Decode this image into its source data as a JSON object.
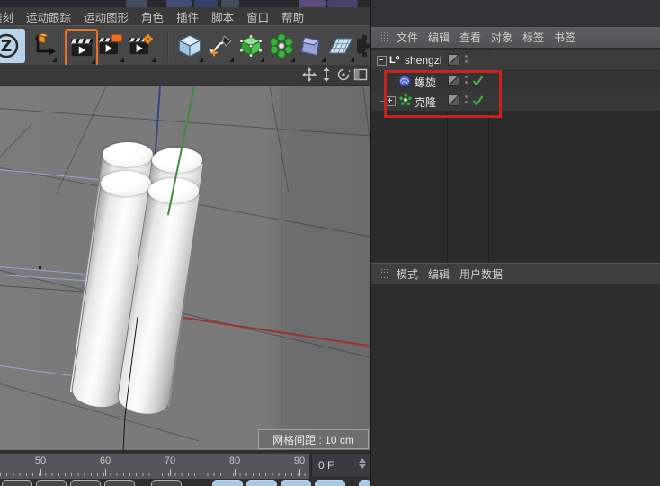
{
  "menubar": {
    "items": [
      "雕刻",
      "运动跟踪",
      "运动图形",
      "角色",
      "插件",
      "脚本",
      "窗口",
      "帮助"
    ]
  },
  "toolbar": {
    "icons": [
      "z-logo-icon",
      "axis-move-icon",
      "render-view-icon",
      "render-region-icon",
      "render-settings-icon",
      "primitive-cube-icon",
      "spline-pen-icon",
      "editable-cube-icon",
      "array-cloner-icon",
      "deformer-icon",
      "floor-grid-icon",
      "gear-icon"
    ]
  },
  "viewport_header": {
    "icons": [
      "pan-icon",
      "dolly-zoom-icon",
      "rotate-icon",
      "maximize-icon"
    ]
  },
  "viewport": {
    "grid_label": "网格间距 : 10 cm"
  },
  "object_manager": {
    "menu": [
      "文件",
      "编辑",
      "查看",
      "对象",
      "标签",
      "书签"
    ],
    "objects": [
      {
        "label": "shengzi",
        "icon": "null-object-icon",
        "icon_glyph": "L⁰",
        "expanded": true,
        "enabled_check": false
      },
      {
        "label": "螺旋",
        "icon": "helix-icon",
        "expanded": null,
        "enabled_check": true
      },
      {
        "label": "克隆",
        "icon": "cloner-icon",
        "expanded": false,
        "enabled_check": true
      }
    ],
    "highlight_box_color": "#c52420"
  },
  "attribute_manager": {
    "menu": [
      "模式",
      "编辑",
      "用户数据"
    ]
  },
  "timeline": {
    "ticks": [
      "50",
      "60",
      "70",
      "80",
      "90"
    ],
    "frame_value": "0 F"
  },
  "colors": {
    "highlight_red": "#c52420",
    "check_green": "#4fae4f",
    "accent_orange": "#e8922a",
    "axis_x_red": "#993333",
    "axis_y_green": "#418a41",
    "axis_z_blue": "#3a4386",
    "workplane_purple": "#9aa2d6"
  }
}
